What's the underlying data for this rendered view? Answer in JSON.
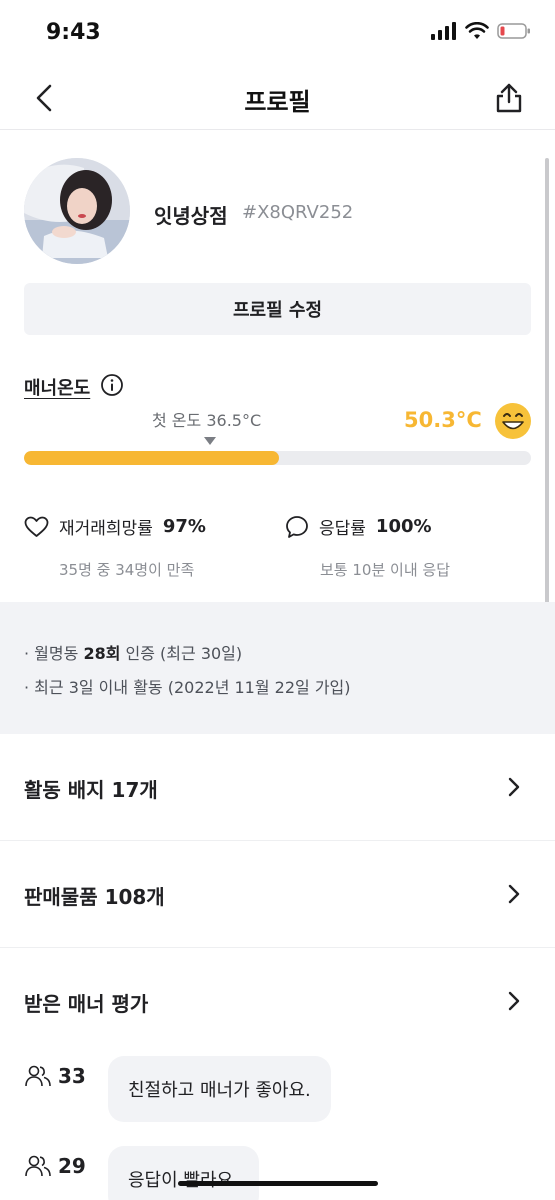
{
  "status_bar": {
    "time": "9:43"
  },
  "nav": {
    "title": "프로필"
  },
  "profile": {
    "nickname": "잇녕상점",
    "user_id": "#X8QRV252",
    "edit_button": "프로필 수정"
  },
  "manner": {
    "label": "매너온도",
    "first_temp": "첫 온도 36.5°C",
    "current_temp": "50.3°C",
    "progress": 0.503,
    "accent": "#f7b733"
  },
  "stats": {
    "rehire": {
      "label": "재거래희망률",
      "value": "97%",
      "sub": "35명 중 34명이 만족"
    },
    "response": {
      "label": "응답률",
      "value": "100%",
      "sub": "보통 10분 이내 응답"
    }
  },
  "info": {
    "line1_prefix": "월명동",
    "line1_bold": "28회",
    "line1_suffix": "인증 (최근 30일)",
    "line2": "최근 3일 이내 활동 (2022년 11월 22일 가입)"
  },
  "menu": [
    {
      "label": "활동 배지 17개"
    },
    {
      "label": "판매물품 108개"
    },
    {
      "label": "받은 매너 평가"
    }
  ],
  "reviews": [
    {
      "count": "33",
      "text": "친절하고 매너가 좋아요."
    },
    {
      "count": "29",
      "text": "응답이 빨라요."
    }
  ],
  "icons": {
    "back": "chevron-left-icon",
    "share": "share-icon",
    "info": "info-icon",
    "face": "smiling-face-icon",
    "heart": "heart-icon",
    "chat": "chat-bubble-icon",
    "people": "people-icon",
    "chevron": "chevron-right-icon"
  }
}
